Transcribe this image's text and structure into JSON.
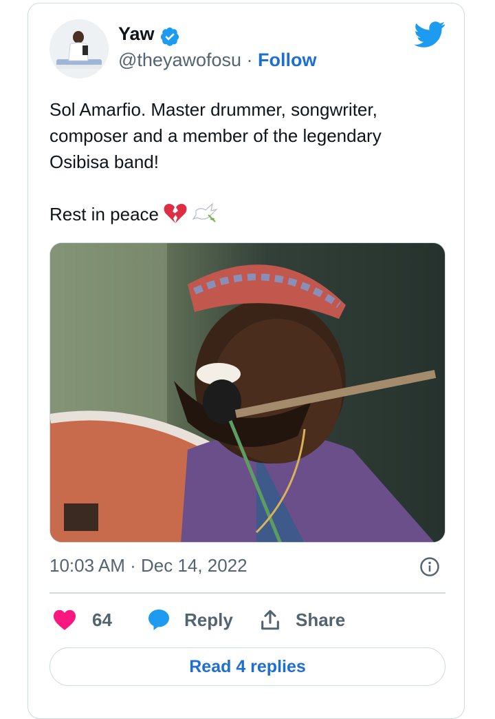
{
  "author": {
    "display_name": "Yaw",
    "handle": "@theyawofosu",
    "separator": "·",
    "follow_label": "Follow"
  },
  "tweet": {
    "line1": "Sol Amarfio. Master drummer, songwriter, composer and a member of the legendary Osibisa band!",
    "line2": "Rest in peace",
    "emojis": [
      "broken-heart-icon",
      "dove-icon"
    ]
  },
  "meta": {
    "timestamp": "10:03 AM · Dec 14, 2022"
  },
  "actions": {
    "like_count": "64",
    "reply_label": "Reply",
    "share_label": "Share"
  },
  "read_replies_label": "Read 4 replies",
  "colors": {
    "accent": "#1d9bf0",
    "link": "#1d6fd1",
    "like": "#f91880",
    "secondary_text": "#536471",
    "border": "#cfd9de"
  }
}
